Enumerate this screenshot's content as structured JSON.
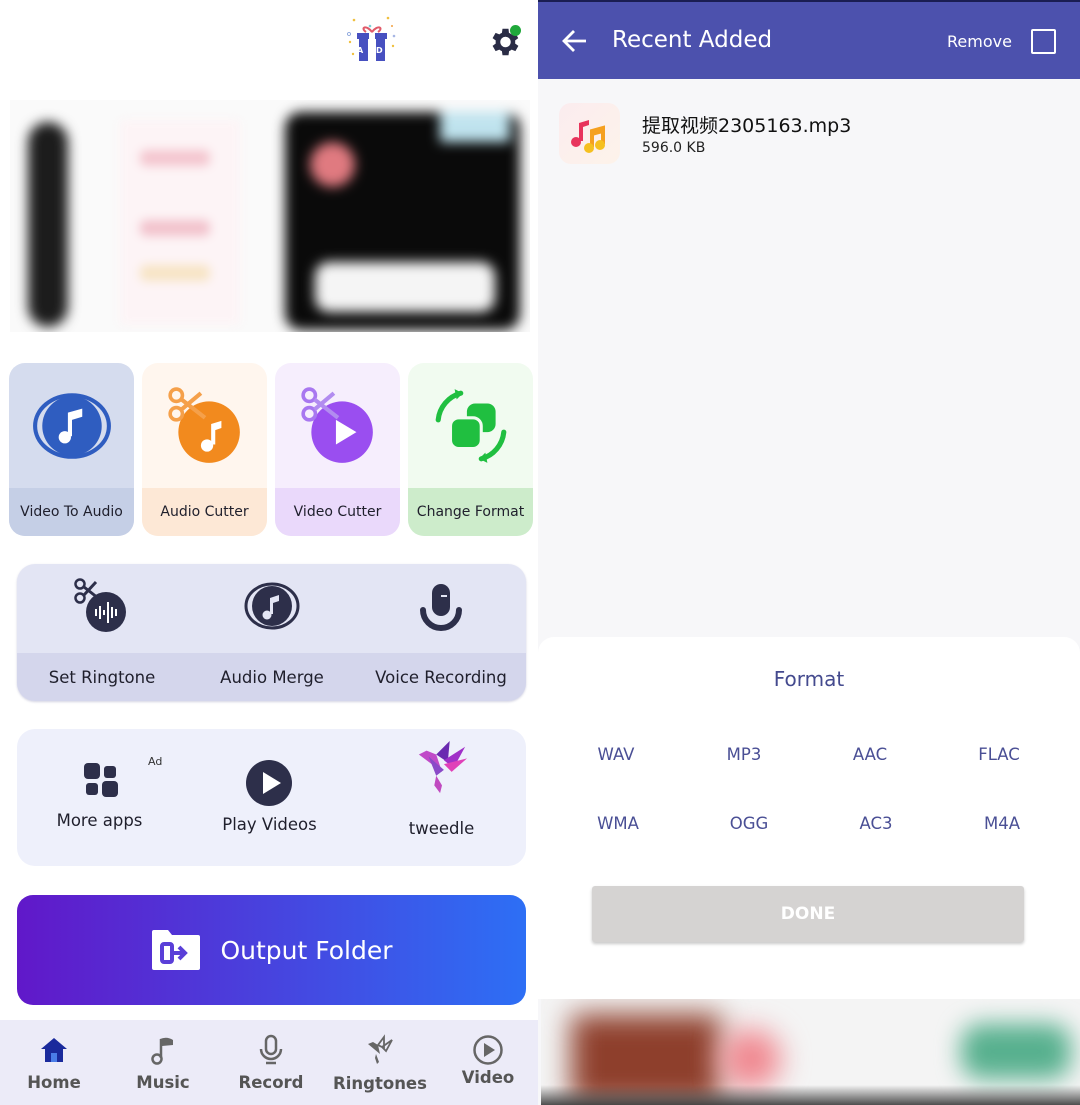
{
  "left": {
    "header": {
      "gift_icon": "gift-ad-icon",
      "gift_letters": "A D",
      "settings_icon": "gear-icon",
      "settings_badge_color": "#1fa83a"
    },
    "banner": {
      "description": "blurred promotional banner"
    },
    "tools": [
      {
        "label": "Video To Audio",
        "icon": "video-to-audio-icon",
        "color": "#2f5dc0"
      },
      {
        "label": "Audio Cutter",
        "icon": "audio-cutter-icon",
        "color": "#f28a1e"
      },
      {
        "label": "Video Cutter",
        "icon": "video-cutter-icon",
        "color": "#9a4ef0"
      },
      {
        "label": "Change Format",
        "icon": "change-format-icon",
        "color": "#20bf40"
      }
    ],
    "secondary_tools": [
      {
        "label": "Set Ringtone",
        "icon": "ringtone-cut-icon"
      },
      {
        "label": "Audio Merge",
        "icon": "audio-merge-icon"
      },
      {
        "label": "Voice Recording",
        "icon": "microphone-icon"
      }
    ],
    "extras": [
      {
        "label": "More apps",
        "icon": "apps-grid-icon",
        "badge": "Ad"
      },
      {
        "label": "Play Videos",
        "icon": "play-circle-icon"
      },
      {
        "label": "tweedle",
        "icon": "tweedle-bird-icon"
      }
    ],
    "output_folder": {
      "label": "Output Folder",
      "icon": "folder-export-icon"
    },
    "nav": [
      {
        "label": "Home",
        "icon": "home-icon",
        "active": true
      },
      {
        "label": "Music",
        "icon": "music-note-icon",
        "active": false
      },
      {
        "label": "Record",
        "icon": "microphone-icon",
        "active": false
      },
      {
        "label": "Ringtones",
        "icon": "bird-icon",
        "active": false
      },
      {
        "label": "Video",
        "icon": "play-circle-icon",
        "active": false
      }
    ],
    "nav_active_color": "#1a2a9c"
  },
  "right": {
    "appbar": {
      "title": "Recent Added",
      "remove_label": "Remove",
      "back_icon": "arrow-left-icon",
      "select_all_checked": false,
      "color": "#4c51ad"
    },
    "files": [
      {
        "name": "提取视频2305163.mp3",
        "size": "596.0 KB",
        "icon": "music-file-icon"
      }
    ],
    "format_sheet": {
      "title": "Format",
      "options": [
        "WAV",
        "MP3",
        "AAC",
        "FLAC",
        "WMA",
        "OGG",
        "AC3",
        "M4A"
      ],
      "done_label": "DONE"
    },
    "bottom_ad": {
      "description": "blurred ad banner"
    }
  }
}
